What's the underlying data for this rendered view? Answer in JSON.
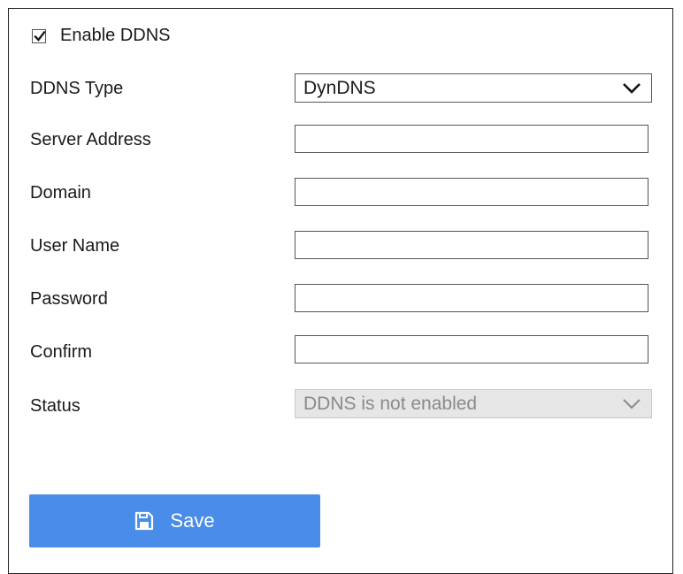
{
  "enable": {
    "label": "Enable DDNS",
    "checked": true
  },
  "form": {
    "ddns_type": {
      "label": "DDNS Type",
      "value": "DynDNS"
    },
    "server_address": {
      "label": "Server Address",
      "value": ""
    },
    "domain": {
      "label": "Domain",
      "value": ""
    },
    "user_name": {
      "label": "User Name",
      "value": ""
    },
    "password": {
      "label": "Password",
      "value": ""
    },
    "confirm": {
      "label": "Confirm",
      "value": ""
    },
    "status": {
      "label": "Status",
      "value": "DDNS is not enabled"
    }
  },
  "save_button": {
    "label": "Save",
    "icon": "save-icon"
  },
  "colors": {
    "accent": "#4a8de8",
    "disabled_bg": "#e6e6e6",
    "checkmark": "#1a1a1a"
  }
}
